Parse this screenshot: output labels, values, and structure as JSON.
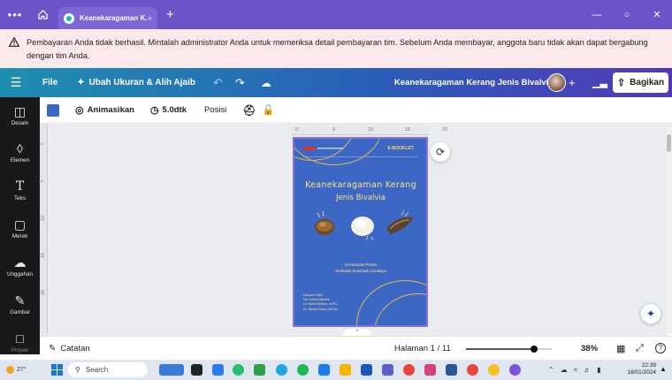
{
  "browser": {
    "tab_title": "Keanekaragaman K...",
    "tab_close": "×",
    "new_tab": "+",
    "dots": "•••"
  },
  "warning": {
    "message": "Pembayaran Anda tidak berhasil. Mintalah administrator Anda untuk memeriksa detail pembayaran tim. Sebelum Anda membayar, anggota baru tidak akan dapat bergabung dengan tim Anda."
  },
  "topbar": {
    "file_label": "File",
    "resize_label": "Ubah Ukuran & Alih Ajaib",
    "doc_title": "Keanekaragaman Kerang Jenis Bivalvia",
    "share_label": "Bagikan"
  },
  "sidebar": {
    "items": [
      {
        "label": "Desain",
        "icon": "layout-icon"
      },
      {
        "label": "Elemen",
        "icon": "shapes-icon"
      },
      {
        "label": "Teks",
        "icon": "text-icon"
      },
      {
        "label": "Merek",
        "icon": "brand-icon"
      },
      {
        "label": "Unggahan",
        "icon": "upload-icon"
      },
      {
        "label": "Gambar",
        "icon": "draw-icon"
      },
      {
        "label": "Proyek",
        "icon": "folder-icon"
      }
    ]
  },
  "toolbar": {
    "color": "#3d67c4",
    "animate_label": "Animasikan",
    "duration_label": "5.0dtk",
    "position_label": "Posisi"
  },
  "ruler": {
    "top_ticks": [
      "0",
      "5",
      "10",
      "15",
      "20"
    ],
    "left_ticks": [
      "0",
      "5",
      "10",
      "15",
      "20"
    ]
  },
  "cover": {
    "ebook_label": "E-BOOKLET",
    "title_line1": "Keanekaragaman Kerang",
    "title_line2": "Jenis Bivalvia",
    "subtitle_line1": "Di Kawasan Pesisir",
    "subtitle_line2": "Jembatan Suramadu Surabaya",
    "authors": [
      "Disusun Oleh:",
      "Nur Aminul Nashih",
      "Dr. Nama Mentor, M.Pd.",
      "Dr. Nama Dosen, M.Kes."
    ]
  },
  "bottombar": {
    "notes_label": "Catatan",
    "page_label": "Halaman 1 / 11",
    "zoom_label": "38%",
    "zoom_fraction": 0.38
  },
  "taskbar": {
    "weather": "27°",
    "search_label": "Search",
    "time": "22:39",
    "date": "16/01/2024"
  }
}
